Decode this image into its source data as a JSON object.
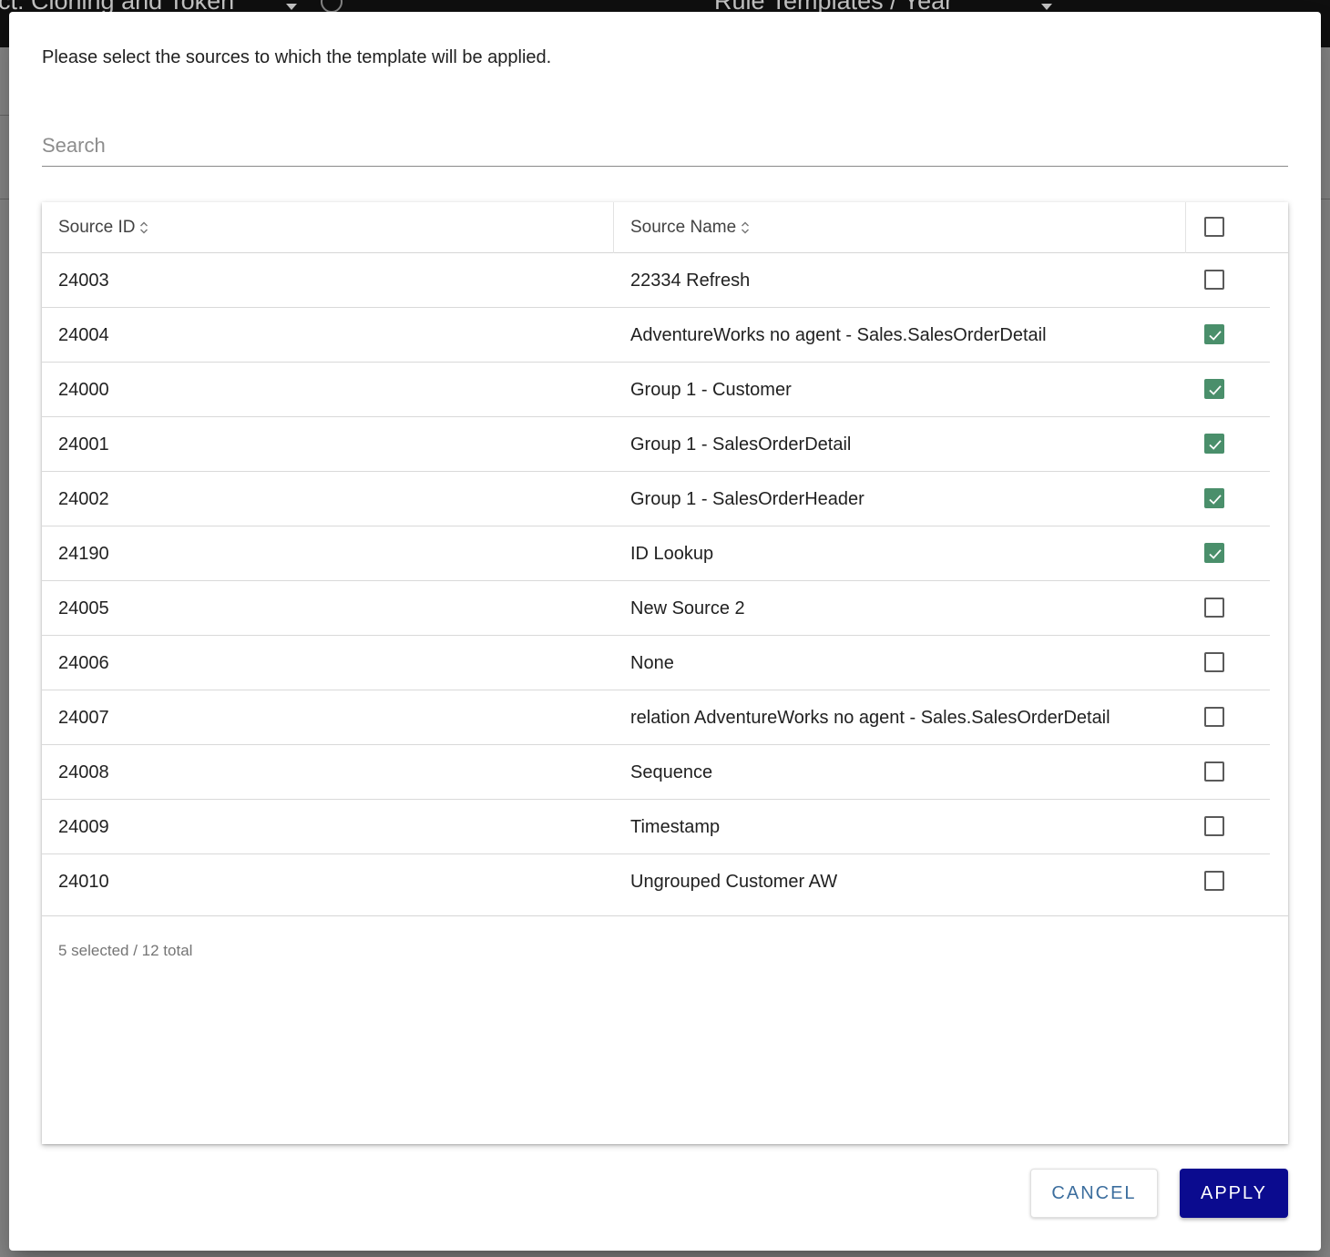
{
  "background": {
    "project_label": "ct: Cloning and Token",
    "breadcrumb": "Rule Templates / Year"
  },
  "dialog": {
    "instruction": "Please select the sources to which the template will be applied.",
    "search": {
      "placeholder": "Search",
      "value": ""
    },
    "table": {
      "columns": [
        {
          "label": "Source ID",
          "sortable": true
        },
        {
          "label": "Source Name",
          "sortable": true
        }
      ],
      "select_all_checked": false,
      "rows": [
        {
          "id": "24003",
          "name": "22334 Refresh",
          "checked": false
        },
        {
          "id": "24004",
          "name": "AdventureWorks no agent - Sales.SalesOrderDetail",
          "checked": true
        },
        {
          "id": "24000",
          "name": "Group 1 - Customer",
          "checked": true
        },
        {
          "id": "24001",
          "name": "Group 1 - SalesOrderDetail",
          "checked": true
        },
        {
          "id": "24002",
          "name": "Group 1 - SalesOrderHeader",
          "checked": true
        },
        {
          "id": "24190",
          "name": "ID Lookup",
          "checked": true
        },
        {
          "id": "24005",
          "name": "New Source 2",
          "checked": false
        },
        {
          "id": "24006",
          "name": "None",
          "checked": false
        },
        {
          "id": "24007",
          "name": "relation AdventureWorks no agent - Sales.SalesOrderDetail",
          "checked": false
        },
        {
          "id": "24008",
          "name": "Sequence",
          "checked": false
        },
        {
          "id": "24009",
          "name": "Timestamp",
          "checked": false
        },
        {
          "id": "24010",
          "name": "Ungrouped Customer AW",
          "checked": false
        }
      ],
      "footer": "5 selected / 12 total"
    },
    "buttons": {
      "cancel": "CANCEL",
      "apply": "APPLY"
    }
  },
  "colors": {
    "checkbox_checked": "#4a8f6b",
    "apply_button": "#0b0b8f",
    "cancel_text": "#3c6e9e"
  }
}
